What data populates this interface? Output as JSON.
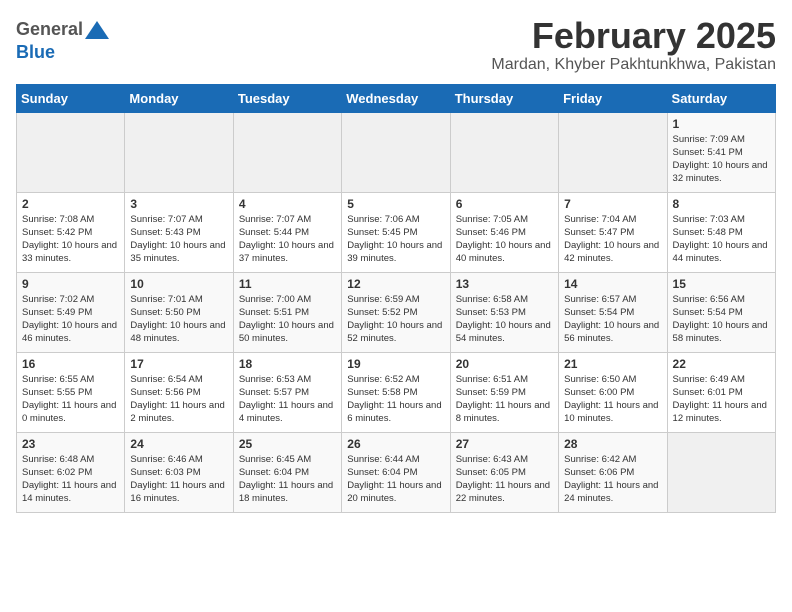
{
  "header": {
    "logo_general": "General",
    "logo_blue": "Blue",
    "month_title": "February 2025",
    "location": "Mardan, Khyber Pakhtunkhwa, Pakistan"
  },
  "weekdays": [
    "Sunday",
    "Monday",
    "Tuesday",
    "Wednesday",
    "Thursday",
    "Friday",
    "Saturday"
  ],
  "weeks": [
    [
      {
        "day": "",
        "info": ""
      },
      {
        "day": "",
        "info": ""
      },
      {
        "day": "",
        "info": ""
      },
      {
        "day": "",
        "info": ""
      },
      {
        "day": "",
        "info": ""
      },
      {
        "day": "",
        "info": ""
      },
      {
        "day": "1",
        "info": "Sunrise: 7:09 AM\nSunset: 5:41 PM\nDaylight: 10 hours and 32 minutes."
      }
    ],
    [
      {
        "day": "2",
        "info": "Sunrise: 7:08 AM\nSunset: 5:42 PM\nDaylight: 10 hours and 33 minutes."
      },
      {
        "day": "3",
        "info": "Sunrise: 7:07 AM\nSunset: 5:43 PM\nDaylight: 10 hours and 35 minutes."
      },
      {
        "day": "4",
        "info": "Sunrise: 7:07 AM\nSunset: 5:44 PM\nDaylight: 10 hours and 37 minutes."
      },
      {
        "day": "5",
        "info": "Sunrise: 7:06 AM\nSunset: 5:45 PM\nDaylight: 10 hours and 39 minutes."
      },
      {
        "day": "6",
        "info": "Sunrise: 7:05 AM\nSunset: 5:46 PM\nDaylight: 10 hours and 40 minutes."
      },
      {
        "day": "7",
        "info": "Sunrise: 7:04 AM\nSunset: 5:47 PM\nDaylight: 10 hours and 42 minutes."
      },
      {
        "day": "8",
        "info": "Sunrise: 7:03 AM\nSunset: 5:48 PM\nDaylight: 10 hours and 44 minutes."
      }
    ],
    [
      {
        "day": "9",
        "info": "Sunrise: 7:02 AM\nSunset: 5:49 PM\nDaylight: 10 hours and 46 minutes."
      },
      {
        "day": "10",
        "info": "Sunrise: 7:01 AM\nSunset: 5:50 PM\nDaylight: 10 hours and 48 minutes."
      },
      {
        "day": "11",
        "info": "Sunrise: 7:00 AM\nSunset: 5:51 PM\nDaylight: 10 hours and 50 minutes."
      },
      {
        "day": "12",
        "info": "Sunrise: 6:59 AM\nSunset: 5:52 PM\nDaylight: 10 hours and 52 minutes."
      },
      {
        "day": "13",
        "info": "Sunrise: 6:58 AM\nSunset: 5:53 PM\nDaylight: 10 hours and 54 minutes."
      },
      {
        "day": "14",
        "info": "Sunrise: 6:57 AM\nSunset: 5:54 PM\nDaylight: 10 hours and 56 minutes."
      },
      {
        "day": "15",
        "info": "Sunrise: 6:56 AM\nSunset: 5:54 PM\nDaylight: 10 hours and 58 minutes."
      }
    ],
    [
      {
        "day": "16",
        "info": "Sunrise: 6:55 AM\nSunset: 5:55 PM\nDaylight: 11 hours and 0 minutes."
      },
      {
        "day": "17",
        "info": "Sunrise: 6:54 AM\nSunset: 5:56 PM\nDaylight: 11 hours and 2 minutes."
      },
      {
        "day": "18",
        "info": "Sunrise: 6:53 AM\nSunset: 5:57 PM\nDaylight: 11 hours and 4 minutes."
      },
      {
        "day": "19",
        "info": "Sunrise: 6:52 AM\nSunset: 5:58 PM\nDaylight: 11 hours and 6 minutes."
      },
      {
        "day": "20",
        "info": "Sunrise: 6:51 AM\nSunset: 5:59 PM\nDaylight: 11 hours and 8 minutes."
      },
      {
        "day": "21",
        "info": "Sunrise: 6:50 AM\nSunset: 6:00 PM\nDaylight: 11 hours and 10 minutes."
      },
      {
        "day": "22",
        "info": "Sunrise: 6:49 AM\nSunset: 6:01 PM\nDaylight: 11 hours and 12 minutes."
      }
    ],
    [
      {
        "day": "23",
        "info": "Sunrise: 6:48 AM\nSunset: 6:02 PM\nDaylight: 11 hours and 14 minutes."
      },
      {
        "day": "24",
        "info": "Sunrise: 6:46 AM\nSunset: 6:03 PM\nDaylight: 11 hours and 16 minutes."
      },
      {
        "day": "25",
        "info": "Sunrise: 6:45 AM\nSunset: 6:04 PM\nDaylight: 11 hours and 18 minutes."
      },
      {
        "day": "26",
        "info": "Sunrise: 6:44 AM\nSunset: 6:04 PM\nDaylight: 11 hours and 20 minutes."
      },
      {
        "day": "27",
        "info": "Sunrise: 6:43 AM\nSunset: 6:05 PM\nDaylight: 11 hours and 22 minutes."
      },
      {
        "day": "28",
        "info": "Sunrise: 6:42 AM\nSunset: 6:06 PM\nDaylight: 11 hours and 24 minutes."
      },
      {
        "day": "",
        "info": ""
      }
    ]
  ]
}
